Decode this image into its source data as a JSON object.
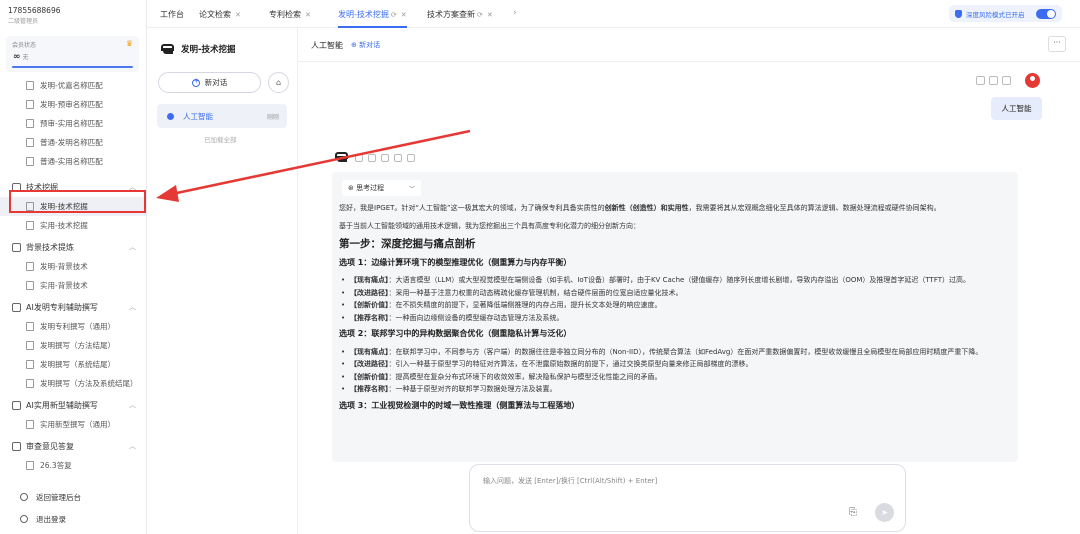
{
  "user": {
    "phone": "17855688696",
    "role": "二级管理员"
  },
  "member": {
    "label": "会员状态",
    "infinity": "∞",
    "quota": "无"
  },
  "menu": {
    "top_items": [
      "发明-优嘉名称匹配",
      "发明-预审名称匹配",
      "预审-实用名称匹配",
      "普通-发明名称匹配",
      "普通-实用名称匹配"
    ],
    "group1": {
      "label": "技术挖掘",
      "items": [
        "发明-技术挖掘",
        "实用-技术挖掘"
      ]
    },
    "group2": {
      "label": "背景技术提炼",
      "items": [
        "发明-背景技术",
        "实用-背景技术"
      ]
    },
    "group3": {
      "label": "AI发明专利辅助撰写",
      "items": [
        "发明专利撰写（通用）",
        "发明撰写（方法结尾）",
        "发明撰写（系统结尾）",
        "发明撰写（方法及系统结尾）"
      ]
    },
    "group4": {
      "label": "AI实用新型辅助撰写",
      "items": [
        "实用新型撰写（通用）"
      ]
    },
    "group5": {
      "label": "审查意见答复",
      "items": [
        "26.3答复"
      ]
    }
  },
  "bottom": {
    "admin": "返回管理后台",
    "logout": "退出登录"
  },
  "tabs": [
    {
      "label": "工作台"
    },
    {
      "label": "论文检索"
    },
    {
      "label": "专利检索"
    },
    {
      "label": "发明-技术挖掘"
    },
    {
      "label": "技术方案查新"
    }
  ],
  "deep_mode": "深度风险模式已开启",
  "col2": {
    "brand": "发明-技术挖掘",
    "new_chat": "新对话",
    "conv_title": "人工智能",
    "conv_time": "刚刚",
    "loaded": "已加载全部"
  },
  "main": {
    "title": "人工智能",
    "new_chat": "新对话",
    "more": "···",
    "user_message": "人工智能",
    "think": "思考过程"
  },
  "answer": {
    "intro": "您好，我是IPGET。针对“人工智能”这一极其宏大的领域，为了确保专利具备实质性的",
    "intro_bold": "创新性（创造性）和实用性",
    "intro_end": "，我需要将其从宏观概念细化至具体的算法逻辑、数据处理流程或硬件协同架构。",
    "lead": "基于当前人工智能领域的通用技术逻辑，我为您挖掘出三个具有高度专利化潜力的细分创新方向：",
    "step1": "第一步：深度挖掘与痛点剖析",
    "opt1": "选项 1：边缘计算环境下的模型推理优化（侧重算力与内存平衡）",
    "opt1_items": [
      {
        "k": "【现有痛点】",
        "v": "：大语言模型（LLM）或大型视觉模型在端侧设备（如手机、IoT设备）部署时，由于KV Cache（键值缓存）随序列长度增长剧增，导致内存溢出（OOM）及推理首字延迟（TTFT）过高。"
      },
      {
        "k": "【改进路径】",
        "v": "：采用一种基于注意力权重的动态稀疏化缓存管理机制，结合硬件层面的位宽自适应量化技术。"
      },
      {
        "k": "【创新价值】",
        "v": "：在不损失精度的前提下，显著降低端侧推理的内存占用，提升长文本处理的响应速度。"
      },
      {
        "k": "【推荐名称】",
        "v": "：一种面向边缘侧设备的模型缓存动态管理方法及系统。"
      }
    ],
    "opt2": "选项 2：联邦学习中的异构数据聚合优化（侧重隐私计算与泛化）",
    "opt2_items": [
      {
        "k": "【现有痛点】",
        "v": "：在联邦学习中，不同参与方（客户端）的数据往往是非独立同分布的（Non-IID），传统聚合算法（如FedAvg）在面对严重数据偏置时，模型收敛缓慢且全局模型在局部应用时精度严重下降。"
      },
      {
        "k": "【改进路径】",
        "v": "：引入一种基于原型学习的特征对齐算法，在不泄露原始数据的前提下，通过交换类原型向量来修正局部梯度的漂移。"
      },
      {
        "k": "【创新价值】",
        "v": "：提高模型在复杂分布式环境下的收敛效率，解决隐私保护与模型泛化性能之间的矛盾。"
      },
      {
        "k": "【推荐名称】",
        "v": "：一种基于原型对齐的联邦学习数据处理方法及装置。"
      }
    ],
    "opt3": "选项 3：工业视觉检测中的时域一致性推理（侧重算法与工程落地）"
  },
  "input": {
    "placeholder": "输入问题，发送 [Enter]/换行 [Ctrl(Alt/Shift) + Enter]"
  },
  "colors": {
    "accent": "#3a6df0",
    "highlight": "#e53935"
  }
}
